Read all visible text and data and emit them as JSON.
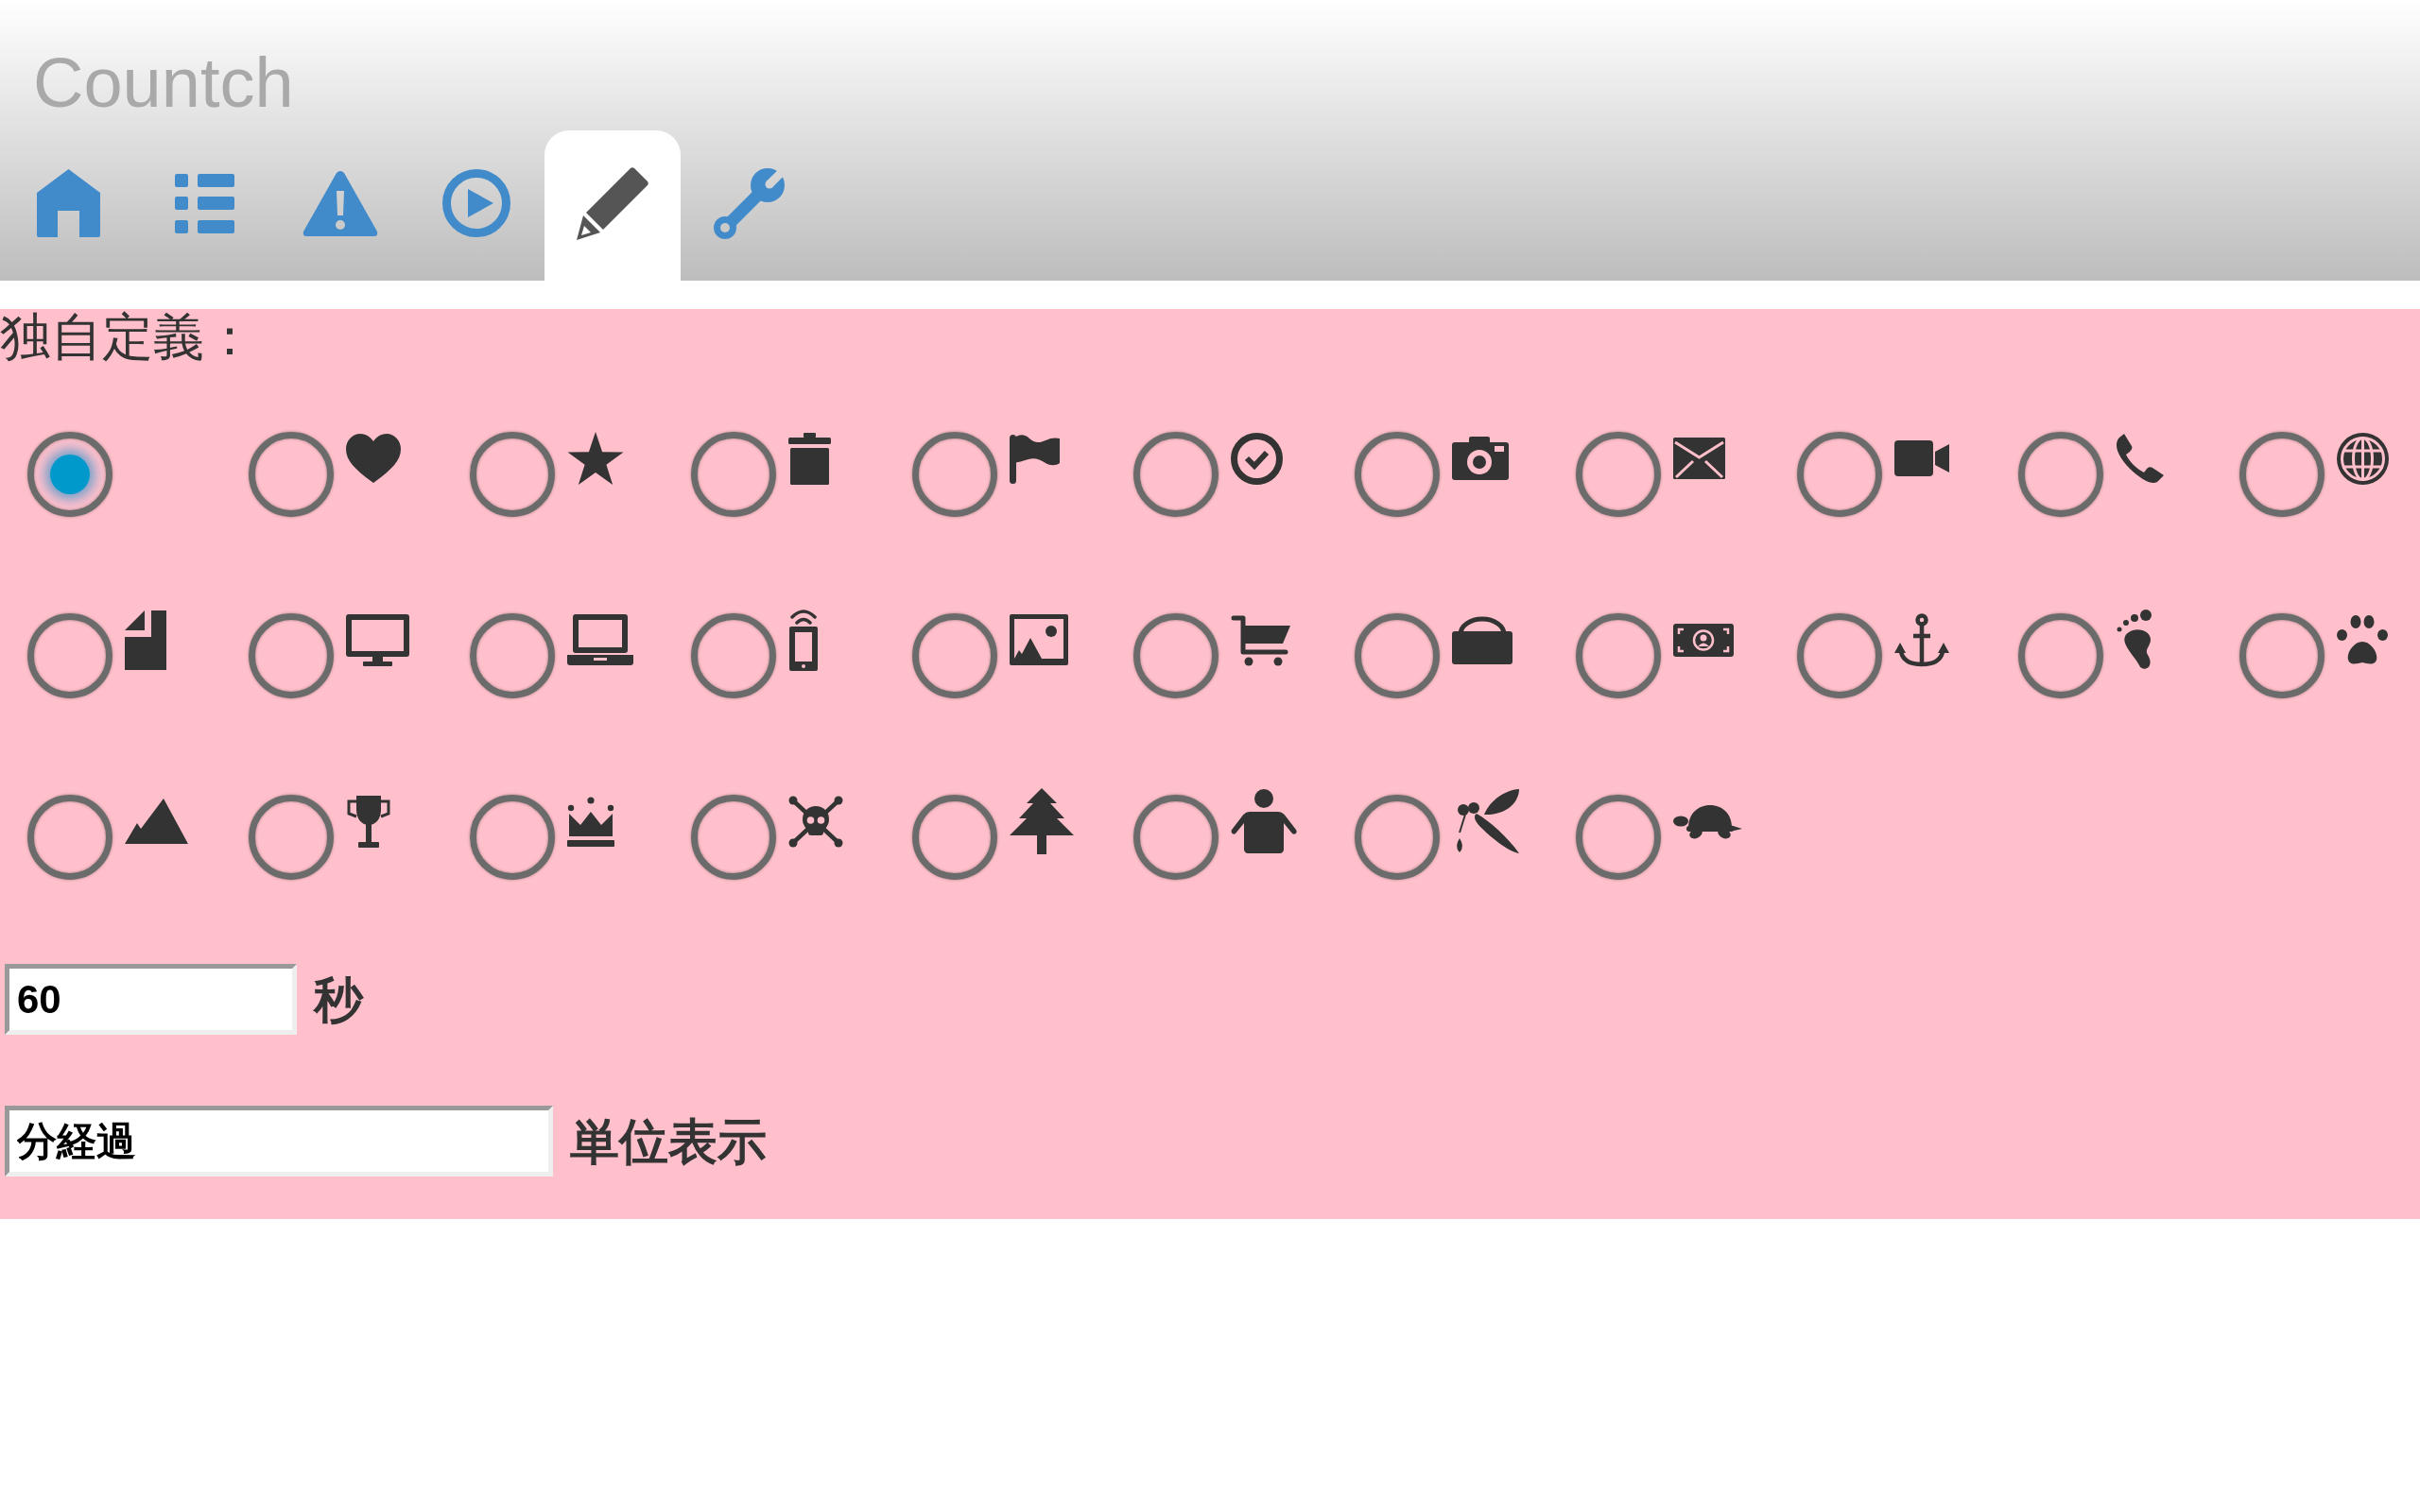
{
  "app": {
    "title": "Countch"
  },
  "tabs": [
    {
      "selected": false
    },
    {
      "selected": false
    },
    {
      "selected": false
    },
    {
      "selected": false
    },
    {
      "selected": true
    },
    {
      "selected": false
    }
  ],
  "custom": {
    "label": "独自定義：",
    "options": [
      {
        "selected": true
      },
      {
        "selected": false
      },
      {
        "selected": false
      },
      {
        "selected": false
      },
      {
        "selected": false
      },
      {
        "selected": false
      },
      {
        "selected": false
      },
      {
        "selected": false
      },
      {
        "selected": false
      },
      {
        "selected": false
      },
      {
        "selected": false
      },
      {
        "selected": false
      },
      {
        "selected": false
      },
      {
        "selected": false
      },
      {
        "selected": false
      },
      {
        "selected": false
      },
      {
        "selected": false
      },
      {
        "selected": false
      },
      {
        "selected": false
      },
      {
        "selected": false
      },
      {
        "selected": false
      },
      {
        "selected": false
      },
      {
        "selected": false
      },
      {
        "selected": false
      },
      {
        "selected": false
      },
      {
        "selected": false
      },
      {
        "selected": false
      },
      {
        "selected": false
      },
      {
        "selected": false
      },
      {
        "selected": false
      }
    ],
    "seconds": {
      "value": "60",
      "unit": "秒"
    },
    "display": {
      "value": "分経過",
      "label": "単位表示"
    }
  }
}
